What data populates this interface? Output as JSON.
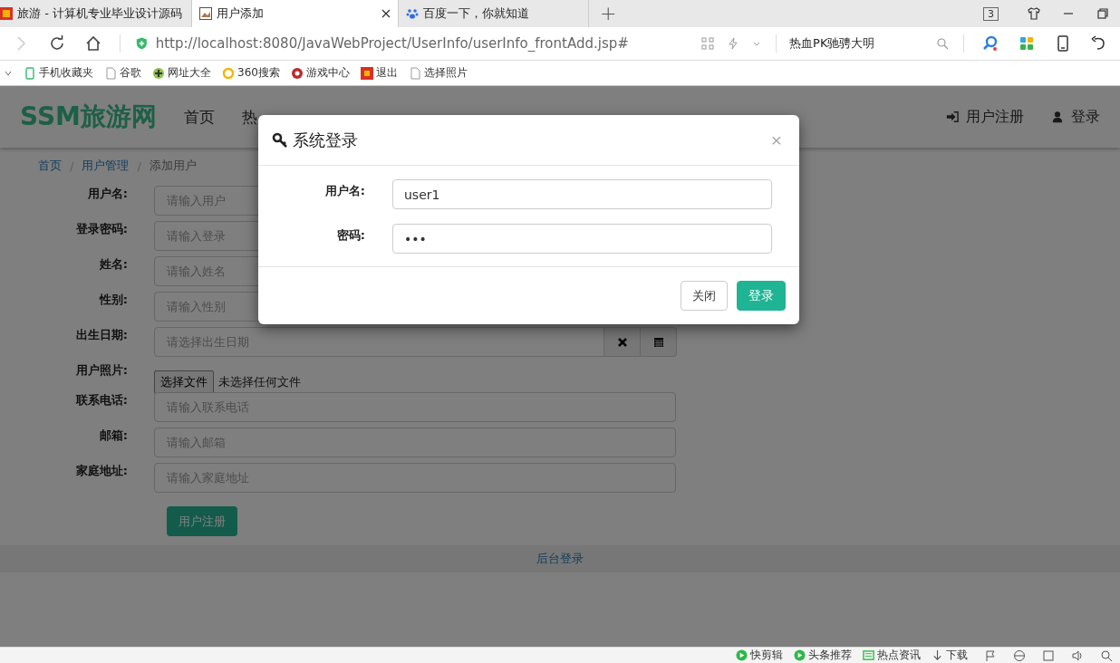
{
  "browser": {
    "tabs": [
      {
        "title": "旅游 - 计算机专业毕业设计源码",
        "selected": false,
        "kind": "red"
      },
      {
        "title": "用户添加",
        "selected": true,
        "kind": "image"
      },
      {
        "title": "百度一下，你就知道",
        "selected": false,
        "kind": "paw"
      }
    ],
    "new_tab": "+",
    "tab_count": "3",
    "address_bar": {
      "url": "http://localhost:8080/JavaWebProject/UserInfo/userInfo_frontAdd.jsp#"
    },
    "search_box": {
      "value": "热血PK驰骋大明"
    },
    "bookmarks": [
      {
        "label": "手机收藏夹",
        "kind": "phone"
      },
      {
        "label": "谷歌",
        "kind": "page"
      },
      {
        "label": "网址大全",
        "kind": "plus"
      },
      {
        "label": "360搜索",
        "kind": "ring"
      },
      {
        "label": "游戏中心",
        "kind": "game"
      },
      {
        "label": "退出",
        "kind": "red"
      },
      {
        "label": "选择照片",
        "kind": "page"
      }
    ],
    "status_bar": [
      {
        "label": "快剪辑",
        "kind": "play"
      },
      {
        "label": "头条推荐",
        "kind": "play"
      },
      {
        "label": "热点资讯",
        "kind": "news"
      },
      {
        "label": "下载",
        "kind": "download"
      }
    ]
  },
  "page": {
    "brand": "SSM旅游网",
    "nav": [
      {
        "label": "首页"
      },
      {
        "label": "热"
      }
    ],
    "nav_right": [
      {
        "label": "用户注册",
        "kind": "register"
      },
      {
        "label": "登录",
        "kind": "login"
      }
    ],
    "breadcrumb_separator": "/",
    "breadcrumb": [
      {
        "label": "首页",
        "selected": false
      },
      {
        "label": "用户管理",
        "selected": false
      },
      {
        "label": "添加用户",
        "selected": true
      }
    ],
    "form": [
      {
        "label": "用户名:",
        "kind": "text",
        "placeholder": "请输入用户"
      },
      {
        "label": "登录密码:",
        "kind": "text",
        "placeholder": "请输入登录"
      },
      {
        "label": "姓名:",
        "kind": "text",
        "placeholder": "请输入姓名"
      },
      {
        "label": "性别:",
        "kind": "text",
        "placeholder": "请输入性别"
      },
      {
        "label": "出生日期:",
        "kind": "date",
        "placeholder": "请选择出生日期"
      },
      {
        "label": "用户照片:",
        "kind": "file",
        "button": "选择文件",
        "status": "未选择任何文件"
      },
      {
        "label": "联系电话:",
        "kind": "text",
        "placeholder": "请输入联系电话"
      },
      {
        "label": "邮箱:",
        "kind": "text",
        "placeholder": "请输入邮箱"
      },
      {
        "label": "家庭地址:",
        "kind": "text",
        "placeholder": "请输入家庭地址"
      }
    ],
    "submit": "用户注册",
    "footer_link": "后台登录"
  },
  "modal": {
    "title": "系统登录",
    "close": "×",
    "fields": [
      {
        "label": "用户名:",
        "value": "user1"
      },
      {
        "label": "密码:",
        "value": "•••"
      }
    ],
    "buttons": [
      {
        "label": "关闭",
        "kind": "default"
      },
      {
        "label": "登录",
        "kind": "primary"
      }
    ]
  }
}
